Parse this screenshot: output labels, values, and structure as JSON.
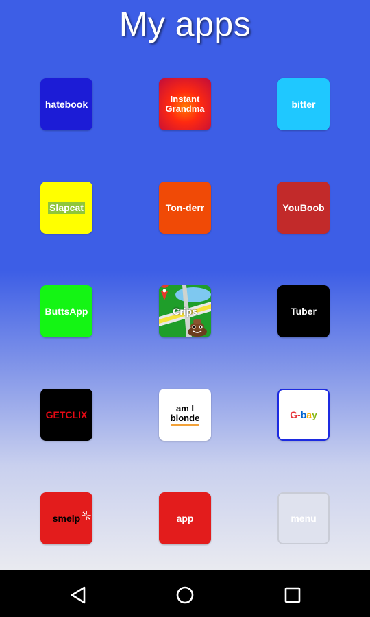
{
  "header": {
    "title": "My apps"
  },
  "apps": [
    {
      "label": "hatebook",
      "bg": "#1c1cd6",
      "color": "#ffffff"
    },
    {
      "label": "Instant\nGrandma",
      "bg": "#e0151a",
      "color": "#ffffff"
    },
    {
      "label": "bitter",
      "bg": "#1fc8ff",
      "color": "#ffffff"
    },
    {
      "label": "Slapcat",
      "bg": "#ffff00",
      "color": "#ffffff"
    },
    {
      "label": "Ton-derr",
      "bg": "#f04a06",
      "color": "#ffffff"
    },
    {
      "label": "YouBoob",
      "bg": "#c22a2a",
      "color": "#ffffff"
    },
    {
      "label": "ButtsApp",
      "bg": "#14f514",
      "color": "#ffffff"
    },
    {
      "label": "Crips",
      "bg": "#1f9e2a",
      "color": "#ffffff"
    },
    {
      "label": "Tuber",
      "bg": "#000000",
      "color": "#ffffff"
    },
    {
      "label": "GETCLIX",
      "bg": "#000000",
      "color": "#e50914"
    },
    {
      "label": "am I\nblonde",
      "bg": "#ffffff",
      "color": "#000000"
    },
    {
      "label": "G-bay",
      "bg": "#ffffff",
      "color": "#e53238"
    },
    {
      "label": "smelp",
      "bg": "#e31c1c",
      "color": "#000000"
    },
    {
      "label": "app",
      "bg": "#e31c1c",
      "color": "#ffffff"
    },
    {
      "label": "menu",
      "bg": "#dfe2ee",
      "color": "#ffffff"
    }
  ],
  "navbar": {
    "back_icon": "back-triangle-icon",
    "home_icon": "home-circle-icon",
    "recents_icon": "recents-square-icon"
  }
}
